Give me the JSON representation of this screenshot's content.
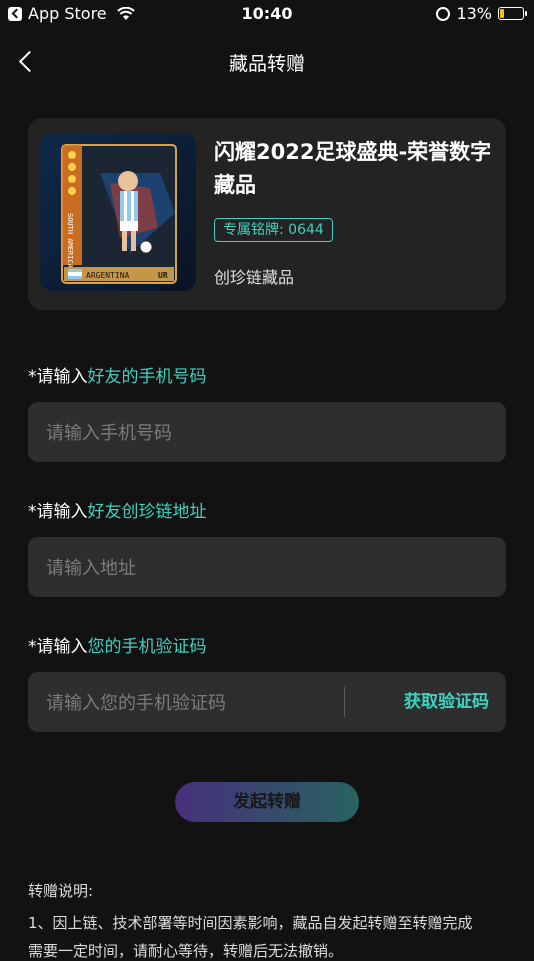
{
  "status": {
    "carrier": "App Store",
    "time": "10:40",
    "battery": "13%"
  },
  "nav": {
    "title": "藏品转赠"
  },
  "card": {
    "title": "闪耀2022足球盛典-荣誉数字藏品",
    "badge": "专属铭牌: 0644",
    "subtitle": "创珍链藏品",
    "image_text": {
      "country": "ARGENTINA",
      "side": "SOUTH AMERICA",
      "code": "UR"
    }
  },
  "form": {
    "phone": {
      "prefix": "*请输入",
      "highlight": "好友的手机号码",
      "placeholder": "请输入手机号码"
    },
    "address": {
      "prefix": "*请输入",
      "highlight": "好友创珍链地址",
      "placeholder": "请输入地址"
    },
    "code": {
      "prefix": "*请输入",
      "highlight": "您的手机验证码",
      "placeholder": "请输入您的手机验证码",
      "action": "获取验证码"
    }
  },
  "submit_label": "发起转赠",
  "notes": {
    "title": "转赠说明:",
    "line1": "1、因上链、技术部署等时间因素影响，藏品自发起转赠至转赠完成",
    "line2": "需要一定时间，请耐心等待，转赠后无法撤销。"
  },
  "colors": {
    "accent": "#3fd1c0",
    "background": "#121212",
    "card": "#232323",
    "field": "#2e2e2e"
  }
}
